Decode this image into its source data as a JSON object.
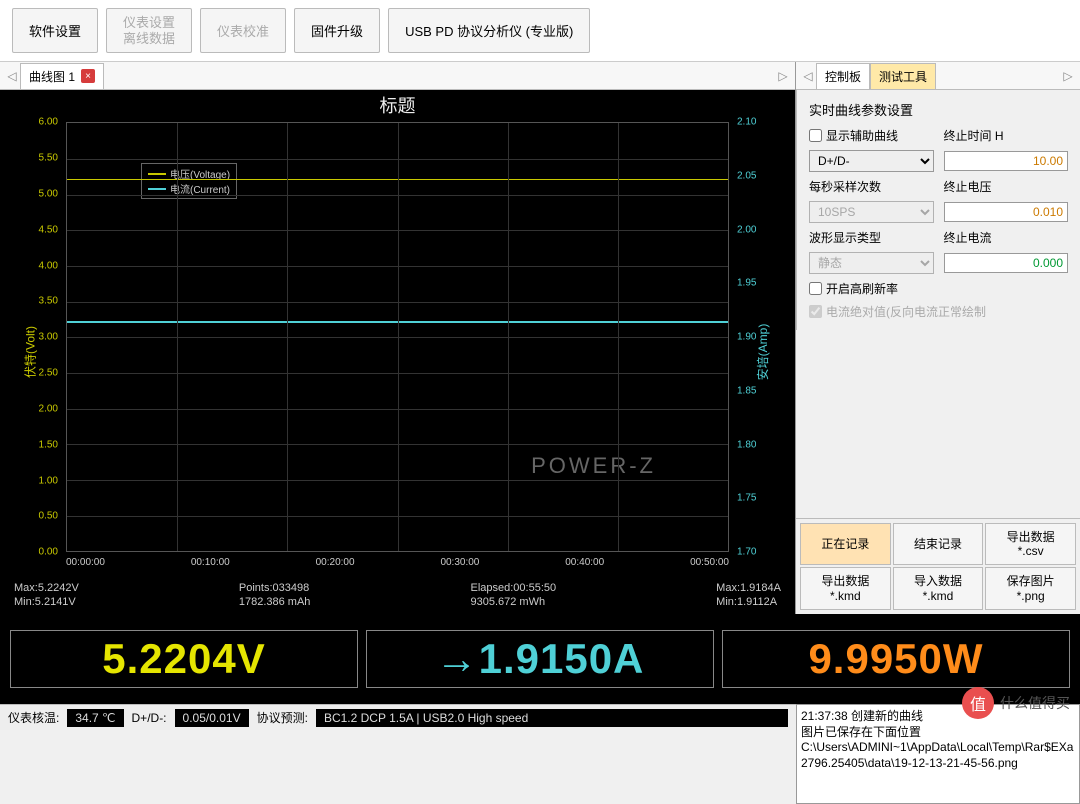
{
  "toolbar": {
    "software_settings": "软件设置",
    "meter_settings": "仪表设置\n离线数据",
    "meter_calibration": "仪表校准",
    "firmware_upgrade": "固件升级",
    "pd_analyzer": "USB PD 协议分析仪 (专业版)"
  },
  "left_tabs": {
    "tab1": "曲线图 1"
  },
  "right_tabs": {
    "control": "控制板",
    "test_tools": "测试工具"
  },
  "chart_data": {
    "type": "line",
    "title": "标题",
    "xlabel": "",
    "ylabel_left": "伏特(Volt)",
    "ylabel_right": "安培(Amp)",
    "ylim_left": [
      0.0,
      6.0
    ],
    "ylim_right": [
      1.7,
      2.1
    ],
    "x_ticks": [
      "00:00:00",
      "00:10:00",
      "00:20:00",
      "00:30:00",
      "00:40:00",
      "00:50:00"
    ],
    "y_ticks_left": [
      "0.00",
      "0.50",
      "1.00",
      "1.50",
      "2.00",
      "2.50",
      "3.00",
      "3.50",
      "4.00",
      "4.50",
      "5.00",
      "5.50",
      "6.00"
    ],
    "y_ticks_right": [
      "1.70",
      "1.75",
      "1.80",
      "1.85",
      "1.90",
      "1.95",
      "2.00",
      "2.05",
      "2.10"
    ],
    "series": [
      {
        "name": "电压(Voltage)",
        "color": "#c9c900",
        "approx_value": 5.22,
        "axis": "left"
      },
      {
        "name": "电流(Current)",
        "color": "#4fd0d6",
        "approx_value": 1.915,
        "axis": "right"
      }
    ],
    "watermark": "POWER-Z"
  },
  "legend": {
    "voltage": "电压(Voltage)",
    "current": "电流(Current)"
  },
  "stats": {
    "max_v": "Max:5.2242V",
    "min_v": "Min:5.2141V",
    "points": "Points:033498",
    "mah": "1782.386 mAh",
    "elapsed": "Elapsed:00:55:50",
    "mwh": "9305.672 mWh",
    "max_a": "Max:1.9184A",
    "min_a": "Min:1.9112A"
  },
  "readouts": {
    "voltage": "5.2204V",
    "current_arrow": "→",
    "current": "1.9150A",
    "power": "9.9950W"
  },
  "statusbar": {
    "temp_label": "仪表核温:",
    "temp_value": "34.7 ℃",
    "dpdm_label": "D+/D-:",
    "dpdm_value": "0.05/0.01V",
    "proto_label": "协议预测:",
    "proto_value": "BC1.2 DCP 1.5A | USB2.0 High speed"
  },
  "control": {
    "section_title": "实时曲线参数设置",
    "show_aux": "显示辅助曲线",
    "aux_select": "D+/D-",
    "end_time_label": "终止时间 H",
    "end_time": "10.00",
    "sps_label": "每秒采样次数",
    "sps": "10SPS",
    "end_v_label": "终止电压",
    "end_v": "0.010",
    "wave_label": "波形显示类型",
    "wave": "静态",
    "end_a_label": "终止电流",
    "end_a": "0.000",
    "high_refresh": "开启高刷新率",
    "abs_current": "电流绝对值(反向电流正常绘制"
  },
  "buttons": {
    "recording": "正在记录",
    "end_record": "结束记录",
    "export_csv": "导出数据\n*.csv",
    "export_kmd": "导出数据\n*.kmd",
    "import_kmd": "导入数据\n*.kmd",
    "save_png": "保存图片\n*.png"
  },
  "log": {
    "line1": "21:37:38 创建新的曲线",
    "line2": "图片已保存在下面位置",
    "line3": "C:\\Users\\ADMINI~1\\AppData\\Local\\Temp\\Rar$EXa2796.25405\\data\\19-12-13-21-45-56.png"
  },
  "footer_wm": {
    "char": "值",
    "text": "什么值得买"
  }
}
